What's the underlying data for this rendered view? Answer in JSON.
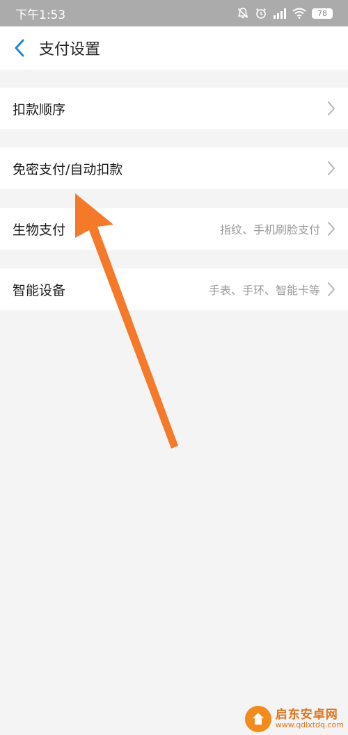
{
  "status_bar": {
    "time": "下午1:53",
    "battery": "78",
    "icons": [
      "mute-bell-icon",
      "alarm-icon",
      "signal-hd-icon",
      "wifi-icon",
      "battery-icon"
    ]
  },
  "header": {
    "back_icon": "chevron-left-icon",
    "title": "支付设置"
  },
  "settings": {
    "items": [
      {
        "label": "扣款顺序",
        "hint": ""
      },
      {
        "label": "免密支付/自动扣款",
        "hint": ""
      },
      {
        "label": "生物支付",
        "hint": "指纹、手机刷脸支付"
      },
      {
        "label": "智能设备",
        "hint": "手表、手环、智能卡等"
      }
    ]
  },
  "colors": {
    "accent_blue": "#1a8ad4",
    "annotation_arrow": "#f47a2a",
    "status_bar": "#ababab",
    "background": "#f4f4f4"
  },
  "watermark": {
    "name": "启东安卓网",
    "url": "www.qdlxtdq.com"
  }
}
